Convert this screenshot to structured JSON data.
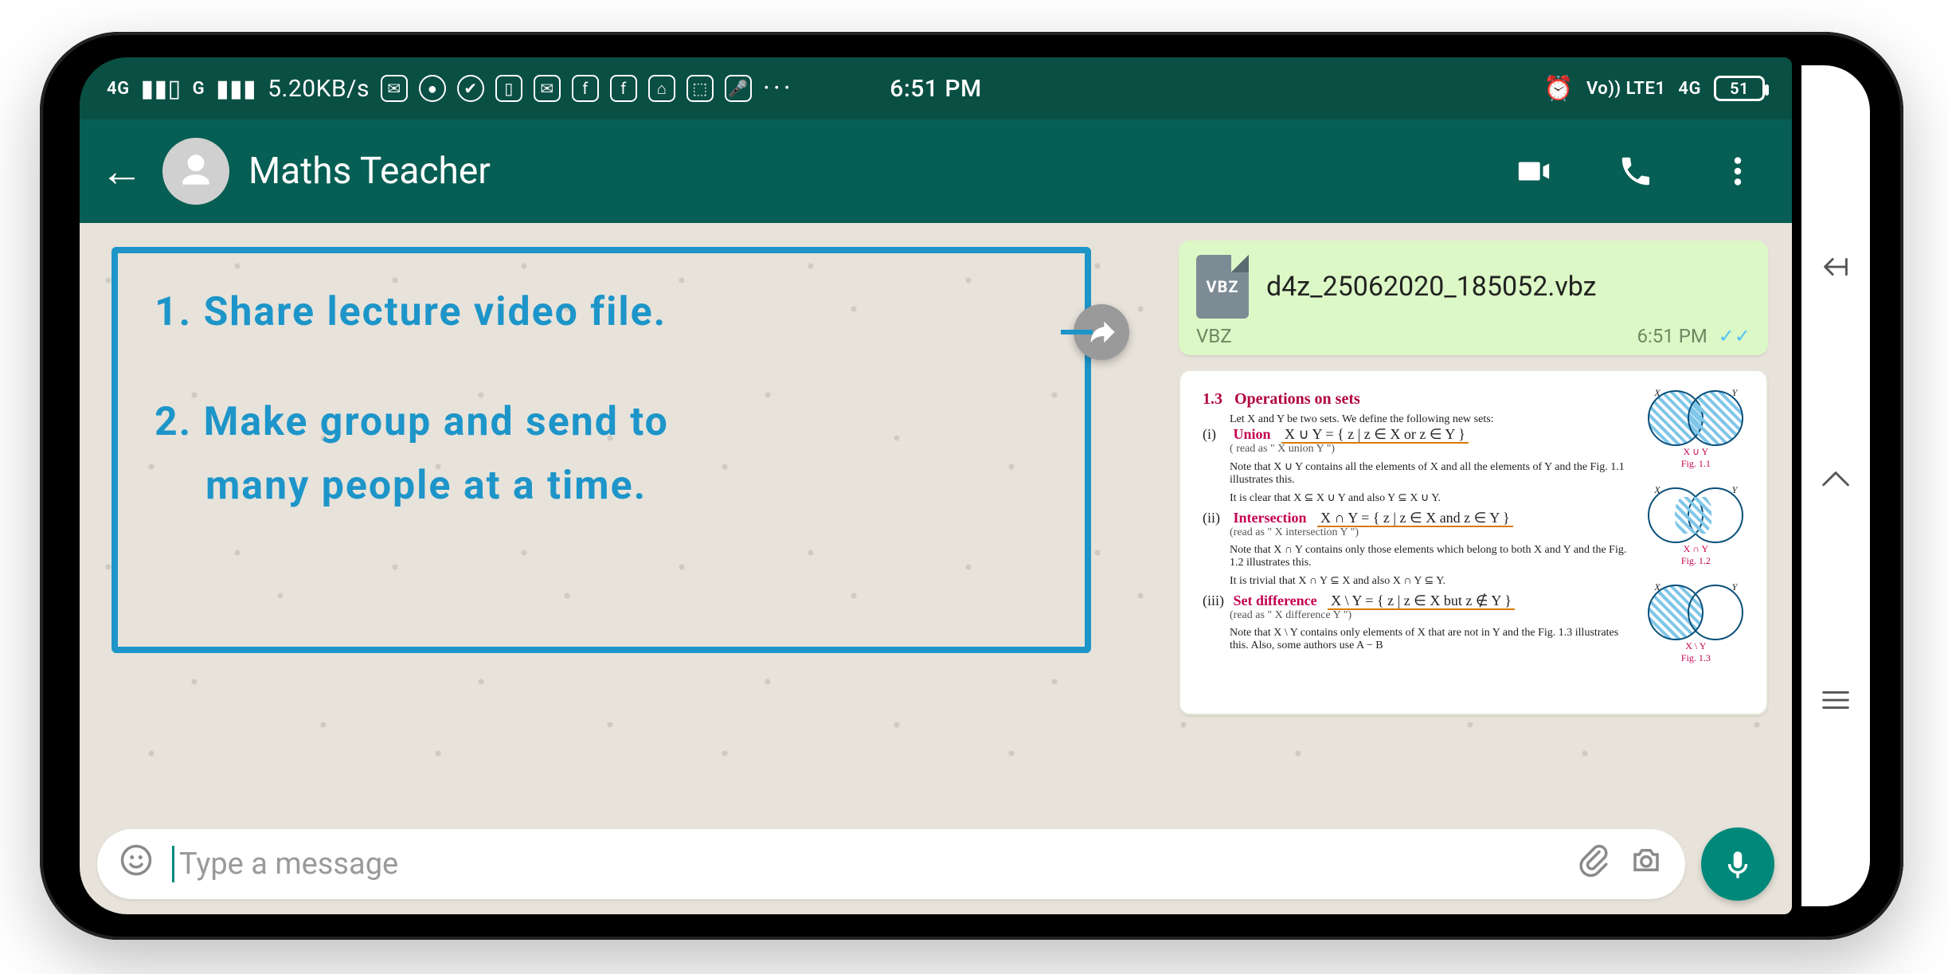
{
  "status_bar": {
    "signal_left": "4G",
    "signal_left2": "G",
    "speed": "5.20KB/s",
    "time": "6:51 PM",
    "volte": "Vo)) LTE1",
    "net4g": "4G",
    "battery": "51",
    "alarm_icon": "⏰",
    "dots": "···"
  },
  "header": {
    "title": "Maths Teacher"
  },
  "callout": {
    "line1": "1. Share lecture video file.",
    "line2a": "2. Make group and send to",
    "line2b": "many people at a time."
  },
  "messages": {
    "file": {
      "badge": "VBZ",
      "name": "d4z_25062020_185052.vbz",
      "ext": "VBZ",
      "time": "6:51 PM"
    },
    "textbook": {
      "section_no": "1.3",
      "section_title": "Operations on sets",
      "intro": "Let X and Y be two sets. We define the following new sets:",
      "items": [
        {
          "idx": "(i)",
          "term": "Union",
          "formula": "X ∪ Y = { z | z ∈ X  or  z ∈ Y }",
          "read": "( read as \" X union Y \")",
          "note1": "Note that X ∪ Y contains all the elements of X and all the elements of Y and the Fig. 1.1 illustrates this.",
          "note2": "It is clear that X ⊆ X ∪ Y and also Y ⊆ X ∪ Y.",
          "fig": "Fig. 1.1"
        },
        {
          "idx": "(ii)",
          "term": "Intersection",
          "formula": "X ∩ Y = { z |  z ∈ X  and  z ∈ Y }",
          "read": "(read as \" X intersection Y \")",
          "note1": "Note that X ∩ Y contains only those elements which belong to both X and Y and the Fig. 1.2 illustrates this.",
          "note2": "It is trivial that X ∩ Y ⊆ X  and also  X ∩ Y ⊆ Y.",
          "fig": "Fig. 1.2"
        },
        {
          "idx": "(iii)",
          "term": "Set difference",
          "formula": "X \\ Y = { z |  z ∈ X  but  z ∉ Y }",
          "read": "(read as \" X difference Y \")",
          "note1": "Note that X \\ Y contains only elements of X that are not in Y and the Fig. 1.3 illustrates this. Also, some authors use A − B",
          "note2": "",
          "fig": "Fig. 1.3"
        }
      ],
      "axis_x": "X",
      "axis_y": "Y",
      "caption_union": "X ∪ Y",
      "caption_inter": "X ∩ Y",
      "caption_diff": "X \\ Y"
    }
  },
  "input": {
    "placeholder": "Type a message"
  }
}
